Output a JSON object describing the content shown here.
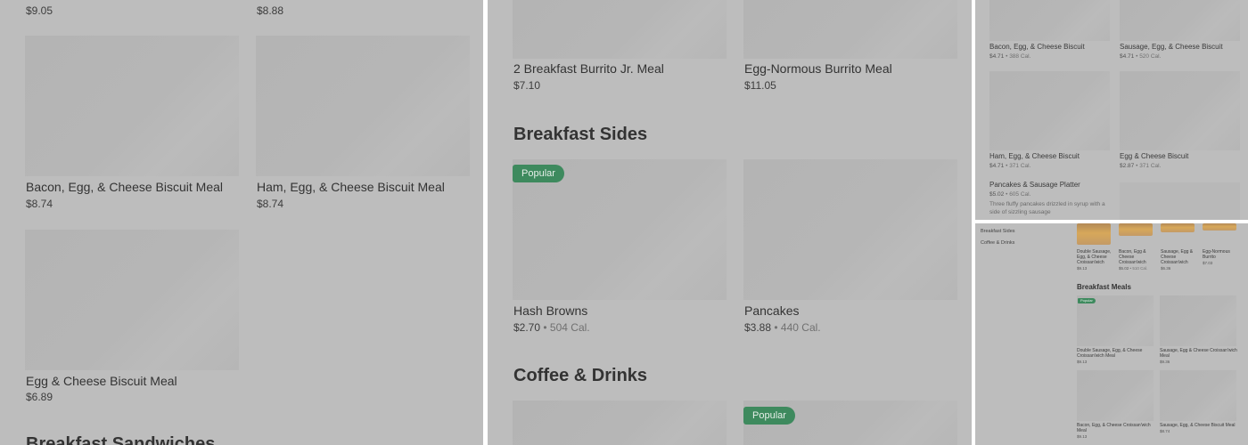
{
  "panel1": {
    "top_prices": [
      "$9.05",
      "$8.88"
    ],
    "items": [
      {
        "name": "Bacon, Egg, & Cheese Biscuit Meal",
        "price": "$8.74"
      },
      {
        "name": "Ham, Egg, & Cheese Biscuit Meal",
        "price": "$8.74"
      },
      {
        "name": "Egg & Cheese Biscuit Meal",
        "price": "$6.89"
      }
    ],
    "section_heading": "Breakfast Sandwiches"
  },
  "panel2": {
    "top_items": [
      {
        "name": "2 Breakfast Burrito Jr. Meal",
        "price": "$7.10"
      },
      {
        "name": "Egg-Normous Burrito Meal",
        "price": "$11.05"
      }
    ],
    "sides_heading": "Breakfast Sides",
    "sides": [
      {
        "name": "Hash Browns",
        "price": "$2.70",
        "calories": "504 Cal."
      },
      {
        "name": "Pancakes",
        "price": "$3.88",
        "calories": "440 Cal."
      }
    ],
    "drinks_heading": "Coffee & Drinks",
    "badge": "Popular",
    "separator": "•"
  },
  "panel3": {
    "items": [
      {
        "name": "Bacon, Egg, & Cheese Biscuit",
        "price": "$4.71",
        "calories": "388 Cal."
      },
      {
        "name": "Sausage, Egg, & Cheese Biscuit",
        "price": "$4.71",
        "calories": "520 Cal."
      },
      {
        "name": "Ham, Egg, & Cheese Biscuit",
        "price": "$4.71",
        "calories": "371 Cal."
      },
      {
        "name": "Egg & Cheese Biscuit",
        "price": "$2.87",
        "calories": "371 Cal."
      }
    ],
    "platter": {
      "name": "Pancakes & Sausage Platter",
      "price": "$5.02",
      "calories": "605 Cal.",
      "description": "Three fluffy pancakes drizzled in syrup with a side of sizzling sausage"
    },
    "separator": "•"
  },
  "panel4": {
    "nav": [
      "Breakfast Sides",
      "Coffee & Drinks"
    ],
    "top_items": [
      {
        "name": "Double Sausage, Egg, & Cheese Croissan'wich",
        "price": "$9.13"
      },
      {
        "name": "Bacon, Egg & Cheese Croissan'wich",
        "price": "$5.02",
        "calories": "510 Cal."
      },
      {
        "name": "Sausage, Egg & Cheese Croissan'wich",
        "price": "$6.36"
      },
      {
        "name": "Egg-Normous Burrito",
        "price": "$7.03"
      }
    ],
    "meals_heading": "Breakfast Meals",
    "badge": "Popular",
    "meals": [
      {
        "name": "Double Sausage, Egg, & Cheese Croissan'wich Meal",
        "price": "$9.13"
      },
      {
        "name": "Sausage, Egg & Cheese Croissan'wich Meal",
        "price": "$9.36"
      },
      {
        "name": "Bacon, Egg, & Cheese Croissan'wich Meal",
        "price": "$9.13"
      },
      {
        "name": "Sausage, Egg, & Cheese Biscuit Meal",
        "price": "$8.74"
      }
    ],
    "separator": "•"
  }
}
